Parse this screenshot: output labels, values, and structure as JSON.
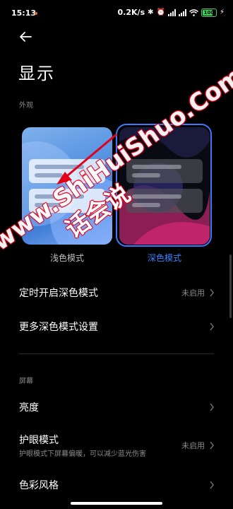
{
  "status_bar": {
    "time": "15:13",
    "speed": "0.2K/s",
    "battery": "100",
    "icons": [
      "bluetooth-icon",
      "alarm-icon",
      "signal-icon",
      "signal-icon",
      "wifi-icon",
      "battery-icon",
      "charging-icon"
    ]
  },
  "header": {
    "title": "显示"
  },
  "appearance": {
    "section_label": "外观",
    "light_label": "浅色模式",
    "dark_label": "深色模式",
    "selected": "dark"
  },
  "rows": {
    "scheduled_dark": {
      "title": "定时开启深色模式",
      "value": "未启用"
    },
    "more_dark": {
      "title": "更多深色模式设置"
    },
    "screen_section": "屏幕",
    "brightness": {
      "title": "亮度"
    },
    "eye_care": {
      "title": "护眼模式",
      "subtitle": "护眼模式下屏幕偏暖，可以减少蓝光伤害",
      "value": "未启用"
    },
    "color_style": {
      "title": "色彩风格"
    }
  },
  "watermark": {
    "text": "www.ShiHuiShuo.Com",
    "cn": "话会说"
  },
  "colors": {
    "accent": "#3b7cff",
    "background": "#000000",
    "watermark_outline": "#e2001a"
  }
}
